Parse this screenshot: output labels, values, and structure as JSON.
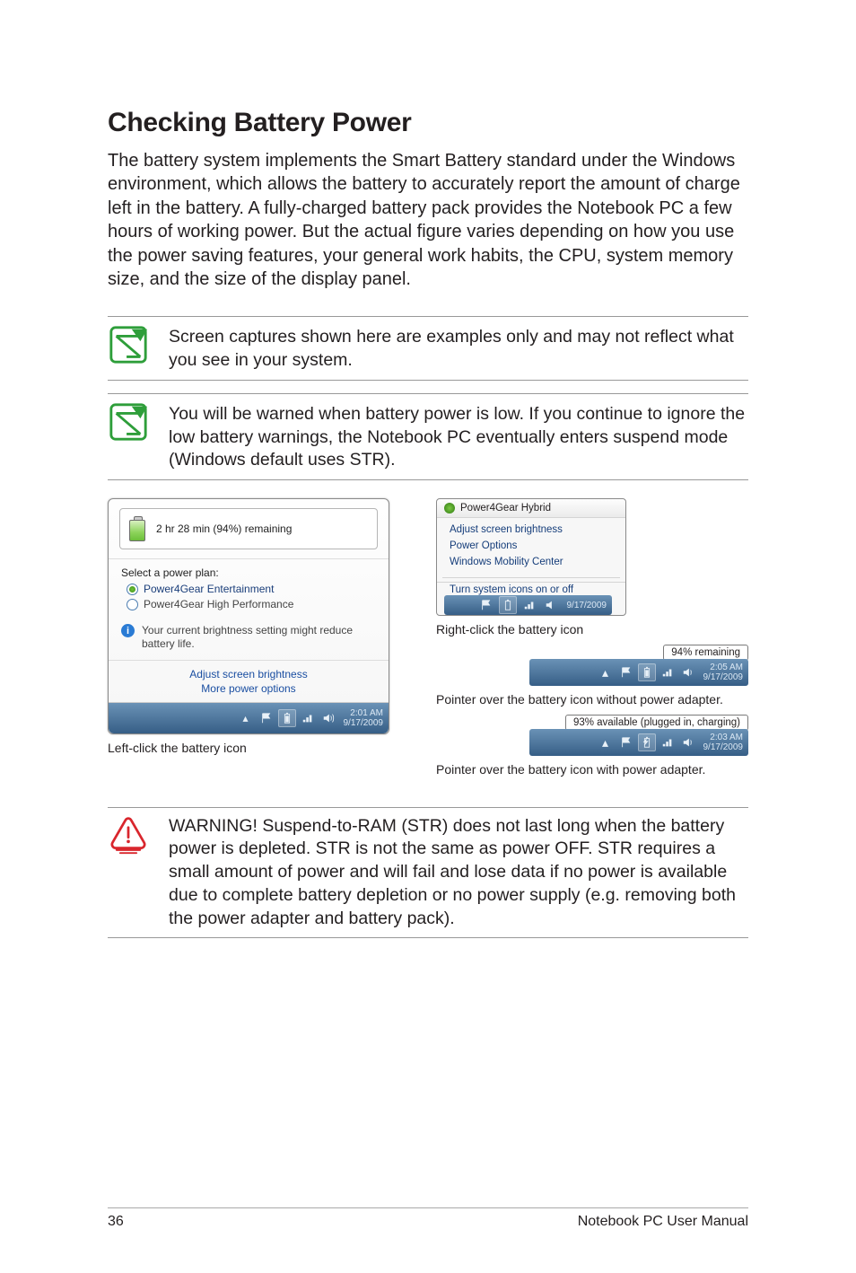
{
  "heading": "Checking Battery Power",
  "intro": "The battery system implements the Smart Battery standard under the Windows environment, which allows the battery to accurately report the amount of charge left in the battery. A fully-charged battery pack provides the Notebook PC a few hours of working power. But the actual figure varies depending on how you use the power saving features, your general work habits, the CPU, system memory size, and the size of the display panel.",
  "note1": "Screen captures shown here are examples only and may not reflect what you see in your system.",
  "note2": "You will be warned when battery power is low. If you continue to ignore the low battery warnings, the Notebook PC eventually enters suspend mode (Windows default uses STR).",
  "left_popup": {
    "remaining": "2 hr 28 min (94%) remaining",
    "plan_title": "Select a power plan:",
    "plan1": "Power4Gear Entertainment",
    "plan2": "Power4Gear High Performance",
    "info": "Your current brightness setting might reduce battery life.",
    "link1": "Adjust screen brightness",
    "link2": "More power options",
    "time": "2:01 AM",
    "date": "9/17/2009"
  },
  "left_caption": "Left-click the battery icon",
  "right_menu": {
    "title": "Power4Gear Hybrid",
    "item1": "Adjust screen brightness",
    "item2": "Power Options",
    "item3": "Windows Mobility Center",
    "item4": "Turn system icons on or off",
    "date": "9/17/2009"
  },
  "right_caption1": "Right-click the battery icon",
  "tooltip1": "94% remaining",
  "tray1_time": "2:05 AM",
  "tray1_date": "9/17/2009",
  "right_caption2": "Pointer over the battery icon without power adapter.",
  "tooltip2": "93% available (plugged in, charging)",
  "tray2_time": "2:03 AM",
  "tray2_date": "9/17/2009",
  "right_caption3": "Pointer over the battery icon with power adapter.",
  "warning": "WARNING!  Suspend-to-RAM (STR) does not last long when the battery power is depleted. STR is not the same as power OFF. STR requires a small amount of power and will fail and lose data if no power is available due to complete battery depletion or no power supply (e.g. removing both the power adapter and battery pack).",
  "page_number": "36",
  "footer_text": "Notebook PC User Manual"
}
